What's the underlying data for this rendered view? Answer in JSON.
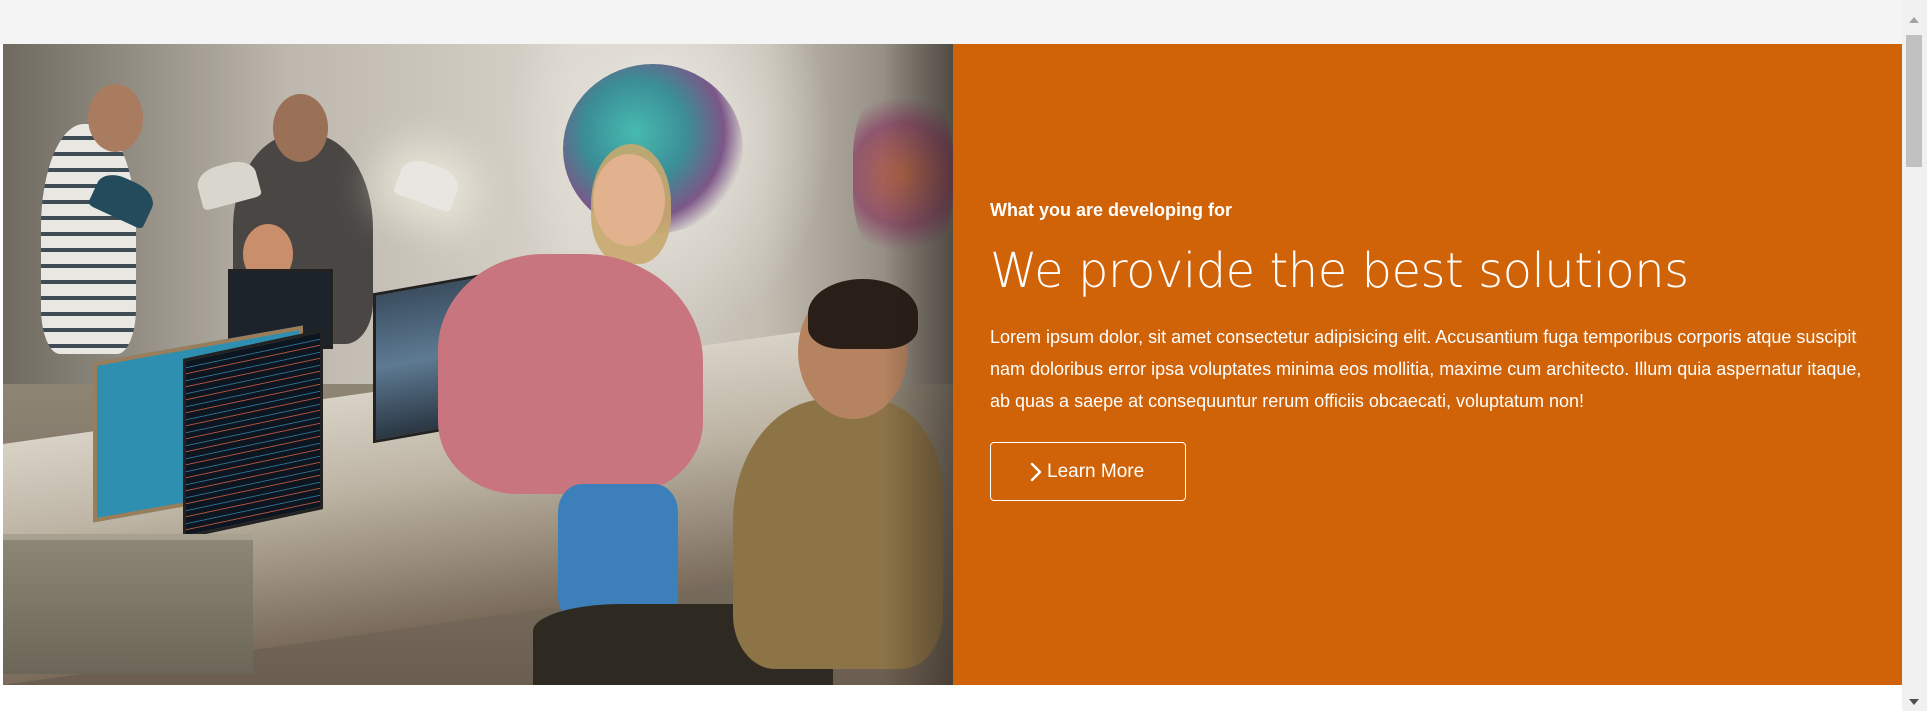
{
  "hero": {
    "eyebrow": "What you are developing for",
    "headline": "We provide the best solutions",
    "body": "Lorem ipsum dolor, sit amet consectetur adipisicing elit. Accusantium fuga temporibus corporis atque suscipit nam doloribus error ipsa voluptates minima eos mollitia, maxime cum architecto. Illum quia aspernatur itaque, ab quas a saepe at consequuntur rerum officiis obcaecati, voluptatum non!",
    "cta_label": "Learn More",
    "cta_icon": "chevron-right-icon",
    "photo_subject": "office-team-photo"
  },
  "colors": {
    "accent": "#d06207",
    "text_on_accent": "#ffffff",
    "page_top_band": "#f4f4f4",
    "page_background": "#ffffff"
  },
  "scrollbar": {
    "icons": [
      "scroll-up-icon",
      "scroll-down-icon"
    ]
  }
}
